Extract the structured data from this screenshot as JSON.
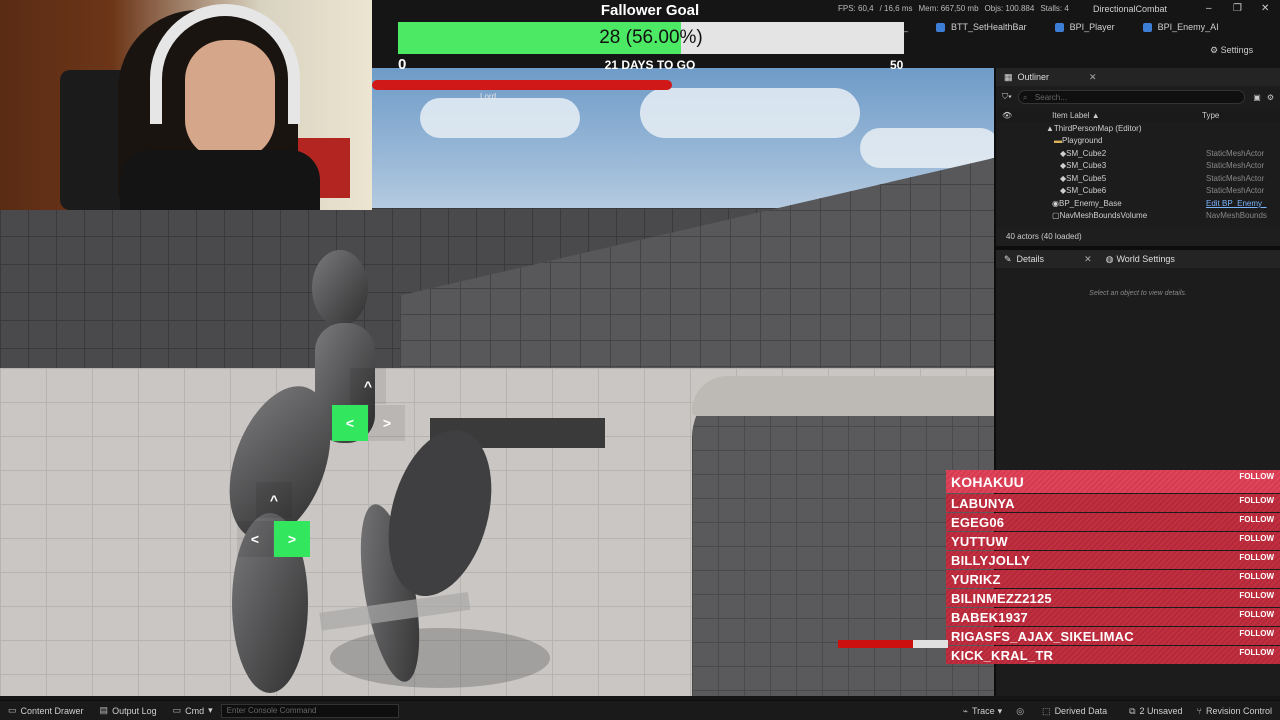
{
  "titlebar": {
    "stats": {
      "fps": "FPS: 60,4",
      "ms": "/ 16,6 ms",
      "mem": "Mem: 667,50 mb",
      "objs": "Objs: 100.884",
      "stalls": "Stalls: 4"
    },
    "project": "DirectionalCombat",
    "min": "–",
    "max": "❐",
    "close": "✕"
  },
  "tabs": [
    {
      "label": "al_"
    },
    {
      "label": "BTT_SetHealthBar"
    },
    {
      "label": "BPI_Player"
    },
    {
      "label": "BPI_Enemy_AI"
    }
  ],
  "settings_label": "Settings",
  "goal": {
    "title": "Fallower Goal",
    "current": 28,
    "percent": 56.0,
    "text": "28 (56.00%)",
    "min": "0",
    "max": "50",
    "days_text": "21 DAYS TO GO"
  },
  "boss": {
    "name": "Lord",
    "health": 1.0
  },
  "arrows": {
    "upper": {
      "up": "^",
      "left": "<",
      "right": ">"
    },
    "lower": {
      "up": "^",
      "left": "<",
      "right": ">"
    }
  },
  "outliner": {
    "title": "Outliner",
    "close": "✕",
    "search_placeholder": "Search...",
    "col_label": "Item Label ▲",
    "col_type": "Type",
    "rows": [
      {
        "label": "ThirdPersonMap (Editor)",
        "type": ""
      },
      {
        "label": "Playground",
        "type": ""
      },
      {
        "label": "SM_Cube2",
        "type": "StaticMeshActor"
      },
      {
        "label": "SM_Cube3",
        "type": "StaticMeshActor"
      },
      {
        "label": "SM_Cube5",
        "type": "StaticMeshActor"
      },
      {
        "label": "SM_Cube6",
        "type": "StaticMeshActor"
      },
      {
        "label": "BP_Enemy_Base",
        "type": "Edit BP_Enemy_"
      },
      {
        "label": "NavMeshBoundsVolume",
        "type": "NavMeshBounds"
      }
    ],
    "footer": "40 actors (40 loaded)"
  },
  "details": {
    "tab_details": "Details",
    "tab_world": "World Settings",
    "close": "✕",
    "empty": "Select an object to view details."
  },
  "followers": [
    {
      "name": "KOHAKUU",
      "action": "FOLLOW"
    },
    {
      "name": "LABUNYA",
      "action": "FOLLOW"
    },
    {
      "name": "EGEG06",
      "action": "FOLLOW"
    },
    {
      "name": "YUTTUW",
      "action": "FOLLOW"
    },
    {
      "name": "BILLYJOLLY",
      "action": "FOLLOW"
    },
    {
      "name": "YURIKZ",
      "action": "FOLLOW"
    },
    {
      "name": "BILINMEZZ2125",
      "action": "FOLLOW"
    },
    {
      "name": "BABEK1937",
      "action": "FOLLOW"
    },
    {
      "name": "RIGASFS_AJAX_SIKELIMAC",
      "action": "FOLLOW"
    },
    {
      "name": "KICK_KRAL_TR",
      "action": "FOLLOW"
    }
  ],
  "enemy_health": 0.68,
  "statusbar": {
    "content_drawer": "Content Drawer",
    "output_log": "Output Log",
    "cmd": "Cmd",
    "console_placeholder": "Enter Console Command",
    "trace": "Trace",
    "derived_data": "Derived Data",
    "unsaved": "2 Unsaved",
    "revision_control": "Revision Control"
  },
  "colors": {
    "goal_fill": "#4ce964",
    "boss_bar": "#d01818",
    "arrow_active": "#32e65e",
    "follower_row": "#c2303f"
  }
}
